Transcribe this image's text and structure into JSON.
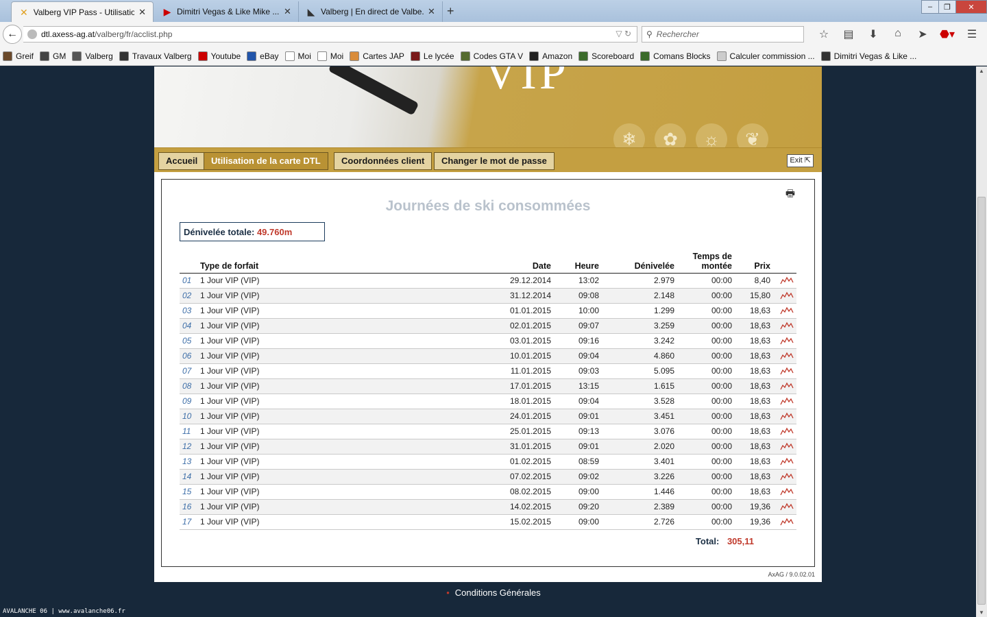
{
  "browser": {
    "tabs": [
      {
        "title": "Valberg VIP Pass - Utilisatio...",
        "icon": "axess-icon",
        "active": true
      },
      {
        "title": "Dimitri Vegas & Like Mike ...",
        "icon": "youtube-icon",
        "active": false
      },
      {
        "title": "Valberg | En direct de Valbe...",
        "icon": "valberg-icon",
        "active": false
      }
    ],
    "url_domain": "dtl.axess-ag.at",
    "url_path": "/valberg/fr/acclist.php",
    "search_placeholder": "Rechercher",
    "bookmarks": [
      {
        "label": "Greif",
        "color": "#6b4a2b"
      },
      {
        "label": "GM",
        "color": "#444444"
      },
      {
        "label": "Valberg",
        "color": "#555555"
      },
      {
        "label": "Travaux Valberg",
        "color": "#333333"
      },
      {
        "label": "Youtube",
        "color": "#cc0000"
      },
      {
        "label": "eBay",
        "color": "#2255aa"
      },
      {
        "label": "Moi",
        "color": "#ffffff"
      },
      {
        "label": "Moi",
        "color": "#ffffff"
      },
      {
        "label": "Cartes JAP",
        "color": "#d98c3a"
      },
      {
        "label": "Le lycée",
        "color": "#7a1a1a"
      },
      {
        "label": "Codes GTA V",
        "color": "#556b2f"
      },
      {
        "label": "Amazon",
        "color": "#222222"
      },
      {
        "label": "Scoreboard",
        "color": "#3b6b2b"
      },
      {
        "label": "Comans Blocks",
        "color": "#3b6b2b"
      },
      {
        "label": "Calculer commission ...",
        "color": "#cccccc"
      },
      {
        "label": "Dimitri Vegas & Like ...",
        "color": "#333333"
      }
    ]
  },
  "site": {
    "menu": [
      "Accueil",
      "Utilisation de la carte DTL",
      "Coordonnées client",
      "Changer le mot de passe"
    ],
    "exit_label": "Exit",
    "title": "Journées de ski consommées",
    "total_elevation_label": "Dénivelée totale:",
    "total_elevation_value": "49.760m",
    "columns": {
      "type": "Type de forfait",
      "date": "Date",
      "time": "Heure",
      "elevation": "Dénivelée",
      "ascent_time_1": "Temps de",
      "ascent_time_2": "montée",
      "price": "Prix"
    },
    "rows": [
      {
        "no": "01",
        "type": "1 Jour VIP (VIP)",
        "date": "29.12.2014",
        "time": "13:02",
        "elev": "2.979",
        "ascent": "00:00",
        "price": "8,40"
      },
      {
        "no": "02",
        "type": "1 Jour VIP (VIP)",
        "date": "31.12.2014",
        "time": "09:08",
        "elev": "2.148",
        "ascent": "00:00",
        "price": "15,80"
      },
      {
        "no": "03",
        "type": "1 Jour VIP (VIP)",
        "date": "01.01.2015",
        "time": "10:00",
        "elev": "1.299",
        "ascent": "00:00",
        "price": "18,63"
      },
      {
        "no": "04",
        "type": "1 Jour VIP (VIP)",
        "date": "02.01.2015",
        "time": "09:07",
        "elev": "3.259",
        "ascent": "00:00",
        "price": "18,63"
      },
      {
        "no": "05",
        "type": "1 Jour VIP (VIP)",
        "date": "03.01.2015",
        "time": "09:16",
        "elev": "3.242",
        "ascent": "00:00",
        "price": "18,63"
      },
      {
        "no": "06",
        "type": "1 Jour VIP (VIP)",
        "date": "10.01.2015",
        "time": "09:04",
        "elev": "4.860",
        "ascent": "00:00",
        "price": "18,63"
      },
      {
        "no": "07",
        "type": "1 Jour VIP (VIP)",
        "date": "11.01.2015",
        "time": "09:03",
        "elev": "5.095",
        "ascent": "00:00",
        "price": "18,63"
      },
      {
        "no": "08",
        "type": "1 Jour VIP (VIP)",
        "date": "17.01.2015",
        "time": "13:15",
        "elev": "1.615",
        "ascent": "00:00",
        "price": "18,63"
      },
      {
        "no": "09",
        "type": "1 Jour VIP (VIP)",
        "date": "18.01.2015",
        "time": "09:04",
        "elev": "3.528",
        "ascent": "00:00",
        "price": "18,63"
      },
      {
        "no": "10",
        "type": "1 Jour VIP (VIP)",
        "date": "24.01.2015",
        "time": "09:01",
        "elev": "3.451",
        "ascent": "00:00",
        "price": "18,63"
      },
      {
        "no": "11",
        "type": "1 Jour VIP (VIP)",
        "date": "25.01.2015",
        "time": "09:13",
        "elev": "3.076",
        "ascent": "00:00",
        "price": "18,63"
      },
      {
        "no": "12",
        "type": "1 Jour VIP (VIP)",
        "date": "31.01.2015",
        "time": "09:01",
        "elev": "2.020",
        "ascent": "00:00",
        "price": "18,63"
      },
      {
        "no": "13",
        "type": "1 Jour VIP (VIP)",
        "date": "01.02.2015",
        "time": "08:59",
        "elev": "3.401",
        "ascent": "00:00",
        "price": "18,63"
      },
      {
        "no": "14",
        "type": "1 Jour VIP (VIP)",
        "date": "07.02.2015",
        "time": "09:02",
        "elev": "3.226",
        "ascent": "00:00",
        "price": "18,63"
      },
      {
        "no": "15",
        "type": "1 Jour VIP (VIP)",
        "date": "08.02.2015",
        "time": "09:00",
        "elev": "1.446",
        "ascent": "00:00",
        "price": "18,63"
      },
      {
        "no": "16",
        "type": "1 Jour VIP (VIP)",
        "date": "14.02.2015",
        "time": "09:20",
        "elev": "2.389",
        "ascent": "00:00",
        "price": "19,36"
      },
      {
        "no": "17",
        "type": "1 Jour VIP (VIP)",
        "date": "15.02.2015",
        "time": "09:00",
        "elev": "2.726",
        "ascent": "00:00",
        "price": "19,36"
      }
    ],
    "total_label": "Total:",
    "total_value": "305,11",
    "version": "AxAG / 9.0.02.01",
    "footer_link": "Conditions Générales"
  },
  "watermark": "AVALANCHE 06 | www.avalanche06.fr",
  "colors": {
    "gold": "#c49f41",
    "accent_red": "#c0392b",
    "navy": "#17283a",
    "link_blue": "#3d6ea8"
  }
}
